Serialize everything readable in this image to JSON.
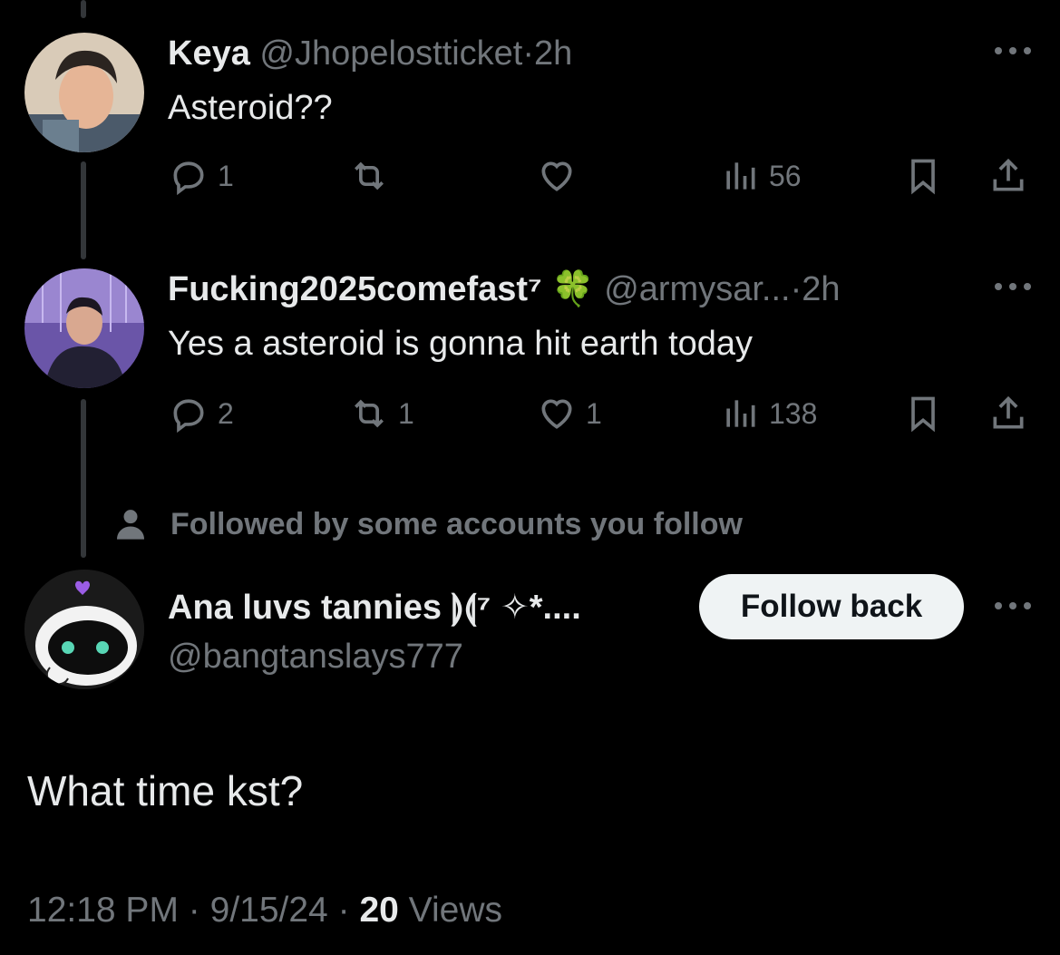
{
  "tweets": [
    {
      "display_name": "Keya",
      "handle": "@Jhopelostticket",
      "separator": "·",
      "time": "2h",
      "text": "Asteroid??",
      "replies": "1",
      "reposts": "",
      "likes": "",
      "views": "56"
    },
    {
      "display_name": "Fucking2025comefast⁷",
      "emoji": "🍀",
      "handle": "@armysar...",
      "separator": "·",
      "time": "2h",
      "text": "Yes a asteroid is gonna hit earth today",
      "replies": "2",
      "reposts": "1",
      "likes": "1",
      "views": "138"
    }
  ],
  "followed_note": "Followed by some accounts you follow",
  "main_tweet": {
    "display_name": "Ana luvs tannies ⟭⟬⁷ ✧*....",
    "handle": "@bangtanslays777",
    "follow_label": "Follow back",
    "text": "What time kst?",
    "time": "12:18 PM",
    "date": "9/15/24",
    "separator": "·",
    "views_count": "20",
    "views_label": "Views"
  },
  "icons": {
    "reply": "reply-icon",
    "repost": "repost-icon",
    "like": "heart-icon",
    "views": "analytics-icon",
    "bookmark": "bookmark-icon",
    "share": "share-icon",
    "more": "more-icon",
    "person": "person-icon"
  },
  "colors": {
    "background": "#000000",
    "text": "#e7e9ea",
    "muted": "#71767b",
    "button_bg": "#eff3f4",
    "thread_line": "#333639"
  }
}
